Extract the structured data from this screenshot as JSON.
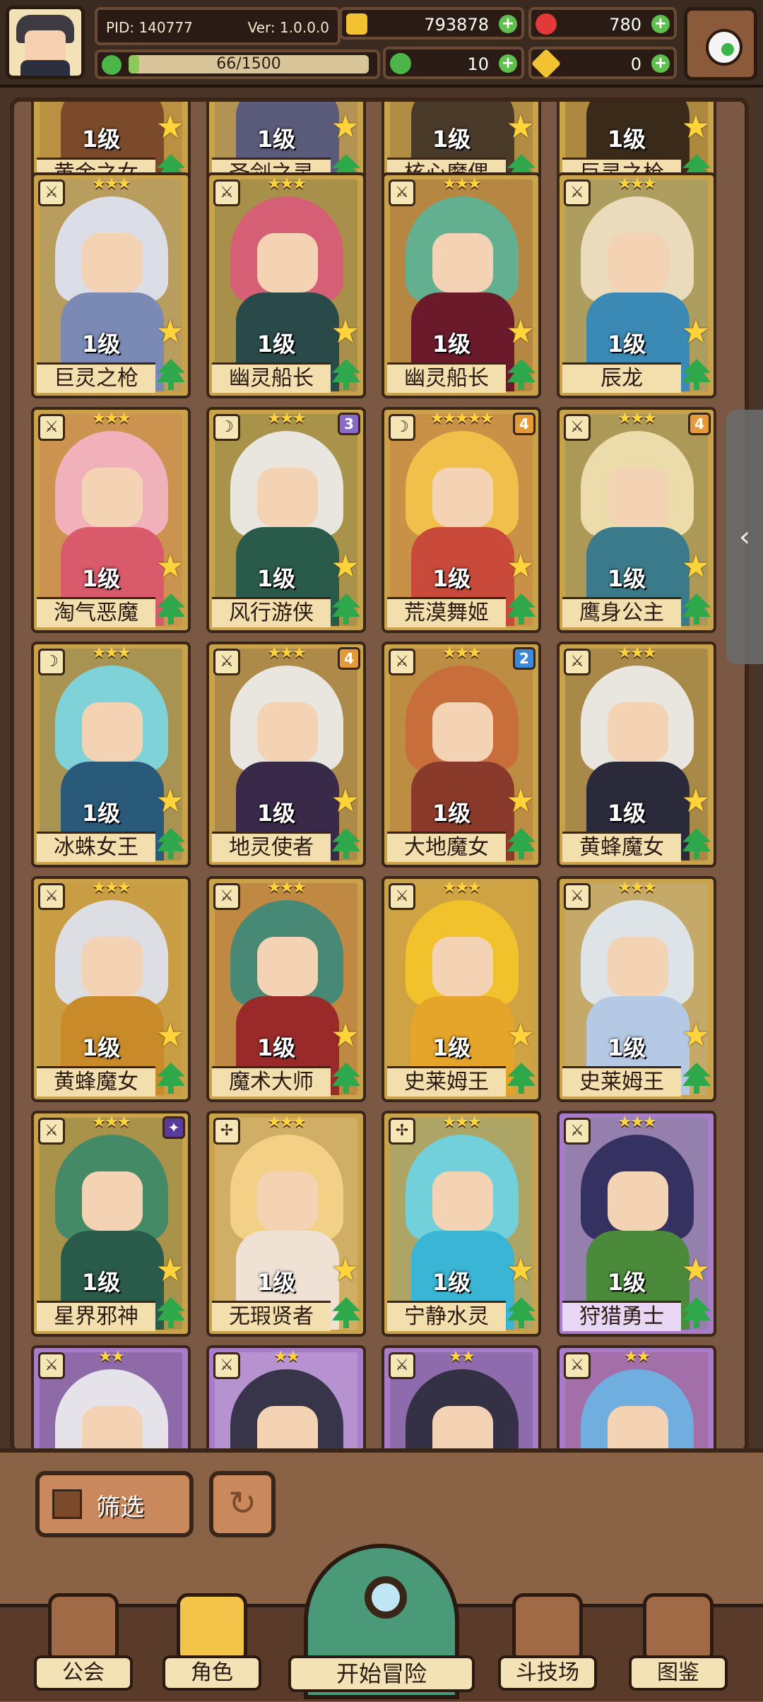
{
  "header": {
    "pid": "PID: 140777",
    "version": "Ver: 1.0.0.0",
    "stamina_text": "66/1500",
    "stamina_fraction": 0.044,
    "gold": "793878",
    "gems": "780",
    "clover": "10",
    "tickets": "0"
  },
  "colors": {
    "gold": "#f2c230",
    "gem": "#e23a3a",
    "clover": "#4bb54a",
    "ticket": "#f2c230"
  },
  "cards": [
    {
      "name": "黄金之女",
      "level": "1级",
      "stars": "★★★",
      "type": "⚔",
      "badge": "",
      "color": "#d9a43a",
      "body": "#7b4a2a",
      "frame": "gold"
    },
    {
      "name": "圣剑之灵",
      "level": "1级",
      "stars": "★★★",
      "type": "⚔",
      "badge": "",
      "color": "#c9c9d9",
      "body": "#5a5a7a",
      "frame": "gold"
    },
    {
      "name": "核心魔偶",
      "level": "1级",
      "stars": "★★★",
      "type": "⚔",
      "badge": "",
      "color": "#8a7a6a",
      "body": "#4a3a2a",
      "frame": "gold"
    },
    {
      "name": "巨灵之枪",
      "level": "1级",
      "stars": "★★★",
      "type": "⚔",
      "badge": "",
      "color": "#7a6a5a",
      "body": "#3a2a1a",
      "frame": "gold"
    },
    {
      "name": "巨灵之枪",
      "level": "1级",
      "stars": "★★★",
      "type": "⚔",
      "badge": "",
      "color": "#dfe6f5",
      "body": "#7a8ab5",
      "frame": "gold"
    },
    {
      "name": "幽灵船长",
      "level": "1级",
      "stars": "★★★",
      "type": "⚔",
      "badge": "",
      "color": "#d95a7a",
      "body": "#2a4a4a",
      "frame": "gold"
    },
    {
      "name": "幽灵船长",
      "level": "1级",
      "stars": "★★★",
      "type": "⚔",
      "badge": "",
      "color": "#5ab59a",
      "body": "#6a1a2a",
      "frame": "gold"
    },
    {
      "name": "辰龙",
      "level": "1级",
      "stars": "★★★",
      "type": "⚔",
      "badge": "",
      "color": "#efe2c5",
      "body": "#3a8ab5",
      "frame": "gold"
    },
    {
      "name": "淘气恶魔",
      "level": "1级",
      "stars": "★★★",
      "type": "⚔",
      "badge": "",
      "color": "#f5b5c5",
      "body": "#d95a6a",
      "frame": "gold"
    },
    {
      "name": "风行游侠",
      "level": "1级",
      "stars": "★★★",
      "type": "☽",
      "badge": "3",
      "badge_color": "#8a6ac9",
      "color": "#efefef",
      "body": "#2a5a4a",
      "frame": "gold"
    },
    {
      "name": "荒漠舞姬",
      "level": "1级",
      "stars": "★★★★★",
      "type": "☽",
      "badge": "4",
      "badge_color": "#e59a3a",
      "color": "#f5c54a",
      "body": "#c94a3a",
      "frame": "gold"
    },
    {
      "name": "鹰身公主",
      "level": "1级",
      "stars": "★★★",
      "type": "⚔",
      "badge": "4",
      "badge_color": "#e59a3a",
      "color": "#f3e2b5",
      "body": "#3a7a8a",
      "frame": "gold"
    },
    {
      "name": "冰蛛女王",
      "level": "1级",
      "stars": "★★★",
      "type": "☽",
      "badge": "",
      "color": "#7ad9e5",
      "body": "#2a5a7a",
      "frame": "gold"
    },
    {
      "name": "地灵使者",
      "level": "1级",
      "stars": "★★★",
      "type": "⚔",
      "badge": "4",
      "badge_color": "#e59a3a",
      "color": "#efefef",
      "body": "#3a2a4a",
      "frame": "gold"
    },
    {
      "name": "大地魔女",
      "level": "1级",
      "stars": "★★★",
      "type": "⚔",
      "badge": "2",
      "badge_color": "#3a8ad9",
      "color": "#c96a3a",
      "body": "#8a3a2a",
      "frame": "gold"
    },
    {
      "name": "黄蜂魔女",
      "level": "1级",
      "stars": "★★★",
      "type": "⚔",
      "badge": "",
      "color": "#efefef",
      "body": "#2a2a3a",
      "frame": "gold"
    },
    {
      "name": "黄蜂魔女",
      "level": "1级",
      "stars": "★★★",
      "type": "⚔",
      "badge": "",
      "color": "#dfe6f5",
      "body": "#c98a2a",
      "frame": "gold"
    },
    {
      "name": "魔术大师",
      "level": "1级",
      "stars": "★★★",
      "type": "⚔",
      "badge": "",
      "color": "#3a8a7a",
      "body": "#9a2a2a",
      "frame": "gold"
    },
    {
      "name": "史莱姆王",
      "level": "1级",
      "stars": "★★★",
      "type": "⚔",
      "badge": "",
      "color": "#f5c52a",
      "body": "#e5a52a",
      "frame": "gold"
    },
    {
      "name": "史莱姆王",
      "level": "1级",
      "stars": "★★★",
      "type": "⚔",
      "badge": "",
      "color": "#dfe9f5",
      "body": "#b5c9e5",
      "frame": "gold"
    },
    {
      "name": "星界邪神",
      "level": "1级",
      "stars": "★★★",
      "type": "⚔",
      "badge": "✦",
      "badge_color": "#5a3a9a",
      "color": "#3a8a6a",
      "body": "#2a5a4a",
      "frame": "gold"
    },
    {
      "name": "无瑕贤者",
      "level": "1级",
      "stars": "★★★",
      "type": "✢",
      "badge": "",
      "color": "#f5d58a",
      "body": "#efe2d5",
      "frame": "gold"
    },
    {
      "name": "宁静水灵",
      "level": "1级",
      "stars": "★★★",
      "type": "✢",
      "badge": "",
      "color": "#6ad5e5",
      "body": "#3ab5d5",
      "frame": "gold"
    },
    {
      "name": "狩猎勇士",
      "level": "1级",
      "stars": "★★★",
      "type": "⚔",
      "badge": "",
      "color": "#2a2a5a",
      "body": "#4a8a3a",
      "frame": "purple"
    },
    {
      "name": "",
      "level": "",
      "stars": "★★",
      "type": "⚔",
      "badge": "",
      "color": "#efefef",
      "body": "#2a2a2a",
      "frame": "purple"
    },
    {
      "name": "",
      "level": "",
      "stars": "★★",
      "type": "⚔",
      "badge": "",
      "color": "#2a2a3a",
      "body": "#efefef",
      "frame": "purple"
    },
    {
      "name": "",
      "level": "",
      "stars": "★★",
      "type": "⚔",
      "badge": "",
      "color": "#2a2a3a",
      "body": "#2a2a3a",
      "frame": "purple"
    },
    {
      "name": "",
      "level": "",
      "stars": "★★",
      "type": "⚔",
      "badge": "",
      "color": "#6ab5e5",
      "body": "#8a3a2a",
      "frame": "purple"
    }
  ],
  "controls": {
    "filter_label": "筛选",
    "reset_icon": "refresh-icon"
  },
  "nav": {
    "guild": "公会",
    "character": "角色",
    "adventure": "开始冒险",
    "arena": "斗技场",
    "codex": "图鉴"
  },
  "side_tab_glyph": "‹"
}
